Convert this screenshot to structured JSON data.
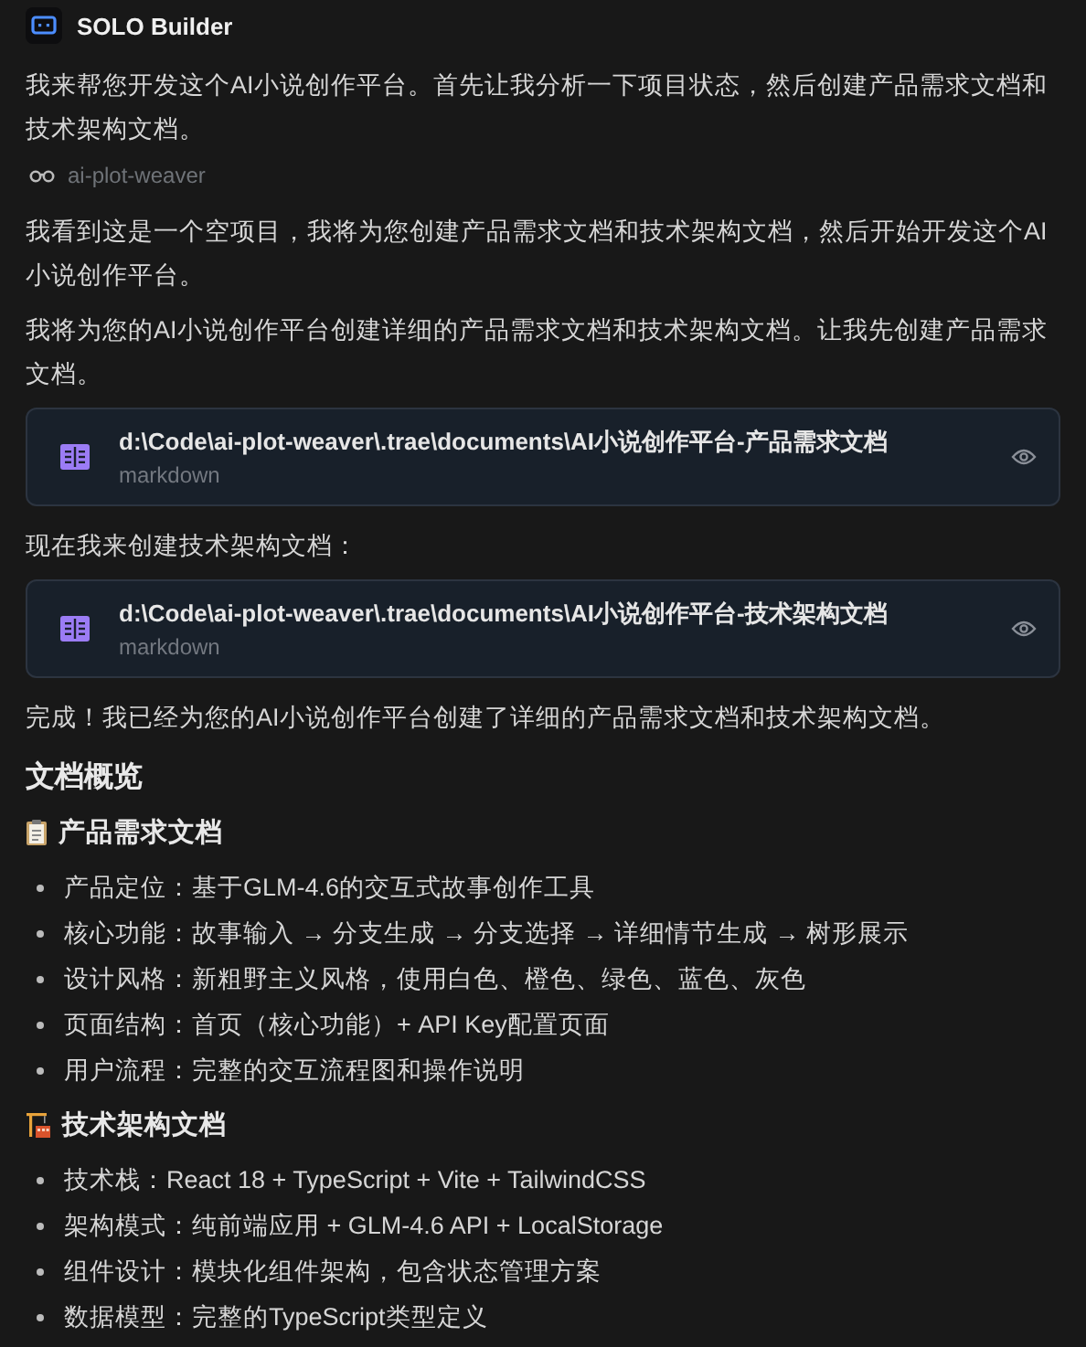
{
  "header": {
    "title": "SOLO Builder"
  },
  "messages": [
    {
      "kind": "text",
      "text": "我来帮您开发这个AI小说创作平台。首先让我分析一下项目状态，然后创建产品需求文档和技术架构文档。"
    },
    {
      "kind": "tool",
      "text": "ai-plot-weaver"
    },
    {
      "kind": "text",
      "text": "我看到这是一个空项目，我将为您创建产品需求文档和技术架构文档，然后开始开发这个AI小说创作平台。"
    },
    {
      "kind": "text",
      "text": "我将为您的AI小说创作平台创建详细的产品需求文档和技术架构文档。让我先创建产品需求文档。"
    },
    {
      "kind": "file",
      "text": "d:\\Code\\ai-plot-weaver\\.trae\\documents\\AI小说创作平台-产品需求文档",
      "subtext": "markdown"
    },
    {
      "kind": "text",
      "text": "现在我来创建技术架构文档："
    },
    {
      "kind": "file",
      "text": "d:\\Code\\ai-plot-weaver\\.trae\\documents\\AI小说创作平台-技术架构文档",
      "subtext": "markdown"
    },
    {
      "kind": "text",
      "text": "完成！我已经为您的AI小说创作平台创建了详细的产品需求文档和技术架构文档。"
    },
    {
      "kind": "heading",
      "text": "文档概览"
    },
    {
      "kind": "subheading",
      "text": "产品需求文档"
    },
    {
      "kind": "bullet",
      "text": "产品定位：基于GLM-4.6的交互式故事创作工具"
    },
    {
      "kind": "bullet",
      "text": "核心功能：故事输入 → 分支生成 → 分支选择 → 详细情节生成 → 树形展示"
    },
    {
      "kind": "bullet",
      "text": "设计风格：新粗野主义风格，使用白色、橙色、绿色、蓝色、灰色"
    },
    {
      "kind": "bullet",
      "text": "页面结构：首页（核心功能）+ API Key配置页面"
    },
    {
      "kind": "bullet",
      "text": "用户流程：完整的交互流程图和操作说明"
    },
    {
      "kind": "subheading",
      "text": "技术架构文档"
    },
    {
      "kind": "bullet",
      "text": "技术栈：React 18 + TypeScript + Vite + TailwindCSS"
    },
    {
      "kind": "bullet",
      "text": "架构模式：纯前端应用 + GLM-4.6 API + LocalStorage"
    },
    {
      "kind": "bullet",
      "text": "组件设计：模块化组件架构，包含状态管理方案"
    },
    {
      "kind": "bullet",
      "text": "数据模型：完整的TypeScript类型定义"
    }
  ]
}
